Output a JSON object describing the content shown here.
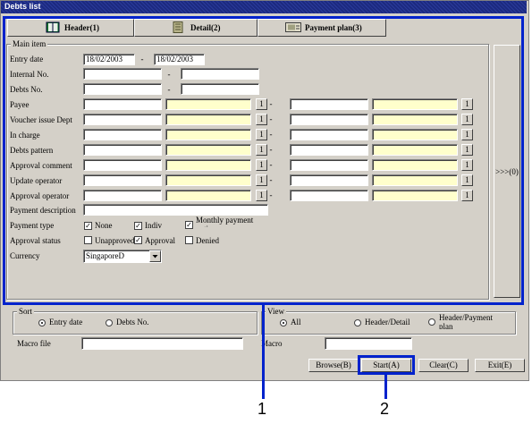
{
  "window": {
    "title": "Debts list"
  },
  "tabs": [
    {
      "label": "Header(1)",
      "icon": "book-icon"
    },
    {
      "label": "Detail(2)",
      "icon": "detail-doc-icon"
    },
    {
      "label": "Payment plan(3)",
      "icon": "payment-plan-icon"
    }
  ],
  "main_group": {
    "legend": "Main item",
    "side_button": ">>>(0)"
  },
  "entry_date": {
    "label": "Entry date",
    "from": "18/02/2003",
    "to": "18/02/2003",
    "sep": "-"
  },
  "internal_no": {
    "label": "Internal No.",
    "sep": "-"
  },
  "debts_no": {
    "label": "Debts No.",
    "sep": "-"
  },
  "ranged_rows": [
    {
      "label": "Payee"
    },
    {
      "label": "Voucher issue Dept"
    },
    {
      "label": "In charge"
    },
    {
      "label": "Debts pattern"
    },
    {
      "label": "Approval comment"
    },
    {
      "label": "Update operator"
    },
    {
      "label": "Approval operator"
    }
  ],
  "lookup_button": "1",
  "range_sep": "-",
  "payment_description": {
    "label": "Payment description"
  },
  "payment_type": {
    "label": "Payment type",
    "options": [
      {
        "label": "None",
        "checked": true
      },
      {
        "label": "Indiv",
        "checked": true
      },
      {
        "label": "Monthly payment notice",
        "checked": true
      }
    ]
  },
  "approval_status": {
    "label": "Approval status",
    "options": [
      {
        "label": "Unapproved",
        "checked": false
      },
      {
        "label": "Approval",
        "checked": true
      },
      {
        "label": "Denied",
        "checked": false
      }
    ]
  },
  "currency": {
    "label": "Currency",
    "value": "SingaporeD"
  },
  "sort": {
    "legend": "Sort",
    "options": [
      {
        "label": "Entry date",
        "selected": true
      },
      {
        "label": "Debts No.",
        "selected": false
      }
    ]
  },
  "view": {
    "legend": "View",
    "options": [
      {
        "label": "All",
        "selected": true
      },
      {
        "label": "Header/Detail",
        "selected": false
      },
      {
        "label": "Header/Payment plan",
        "selected": false
      }
    ]
  },
  "macro_file": {
    "label": "Macro file"
  },
  "macro": {
    "label": "Macro"
  },
  "buttons": {
    "browse": "Browse(B)",
    "start": "Start(A)",
    "clear": "Clear(C)",
    "exit": "Exit(E)"
  },
  "callouts": {
    "one": "1",
    "two": "2"
  },
  "colors": {
    "highlight": "#0022cc",
    "required_field": "#ffffcc",
    "face": "#d4d0c8"
  }
}
